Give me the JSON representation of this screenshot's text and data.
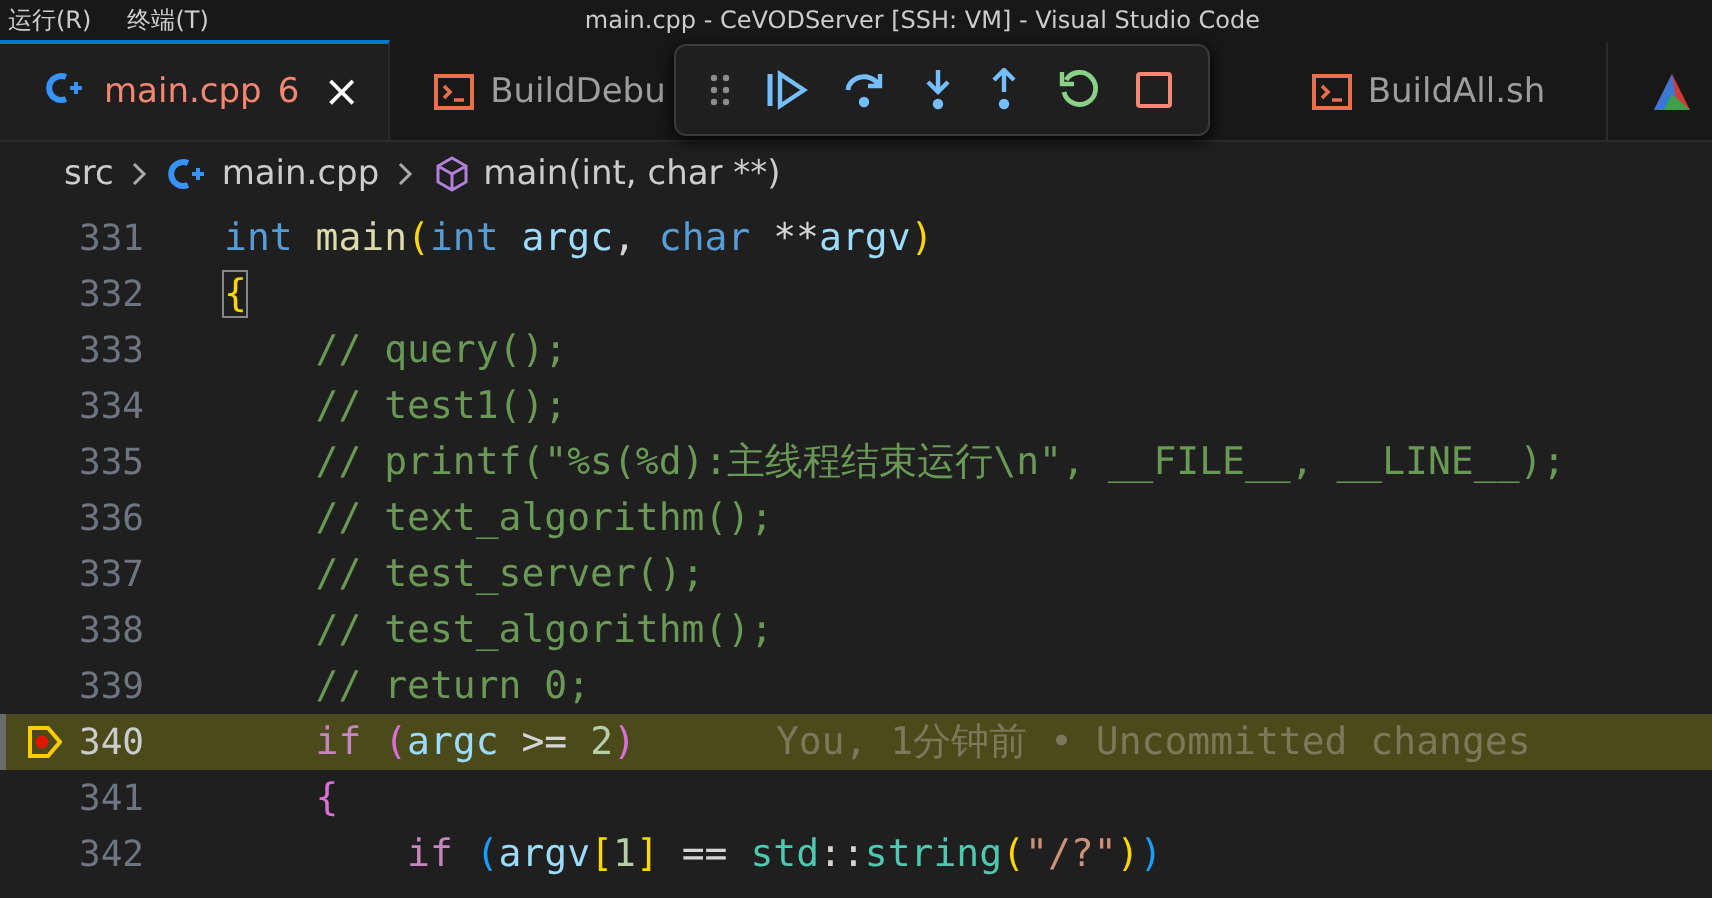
{
  "title_bar": {
    "menus": [
      "运行(R)",
      "终端(T)"
    ],
    "title": "main.cpp - CeVODServer [SSH: VM] - Visual Studio Code"
  },
  "tabs": [
    {
      "label": "main.cpp",
      "kind": "cpp",
      "problems": "6",
      "close": "×",
      "selected": true,
      "error": true
    },
    {
      "label": "BuildDebu",
      "kind": "shell",
      "selected": false,
      "error": false
    },
    {
      "label": "BuildAll.sh",
      "kind": "shell",
      "selected": false,
      "error": false
    },
    {
      "kind": "triangle",
      "selected": false
    }
  ],
  "debug_toolbar": [
    {
      "kind": "drag"
    },
    {
      "kind": "continue"
    },
    {
      "kind": "step-over"
    },
    {
      "kind": "step-into"
    },
    {
      "kind": "step-out"
    },
    {
      "kind": "restart"
    },
    {
      "kind": "stop"
    }
  ],
  "breadcrumb": [
    {
      "kind": "folder",
      "label": "src"
    },
    {
      "kind": "cpp",
      "label": "main.cpp"
    },
    {
      "kind": "symbol",
      "label": "main(int, char **)"
    }
  ],
  "lines": [
    {
      "number": "331",
      "current": false,
      "breakpoint": false,
      "tokens": [
        {
          "kind": "kw",
          "text": "int "
        },
        {
          "kind": "fn",
          "text": "main"
        },
        {
          "kind": "b1",
          "text": "("
        },
        {
          "kind": "kw",
          "text": "int "
        },
        {
          "kind": "var",
          "text": "argc"
        },
        {
          "kind": "plain",
          "text": ", "
        },
        {
          "kind": "kw",
          "text": "char"
        },
        {
          "kind": "plain",
          "text": " **"
        },
        {
          "kind": "var",
          "text": "argv"
        },
        {
          "kind": "b1",
          "text": ")"
        }
      ]
    },
    {
      "number": "332",
      "current": false,
      "breakpoint": false,
      "tokens": [
        {
          "kind": "b1match",
          "text": "{"
        }
      ]
    },
    {
      "number": "333",
      "current": false,
      "breakpoint": false,
      "tokens": [
        {
          "kind": "comment",
          "text": "    // query();"
        }
      ]
    },
    {
      "number": "334",
      "current": false,
      "breakpoint": false,
      "tokens": [
        {
          "kind": "comment",
          "text": "    // test1();"
        }
      ]
    },
    {
      "number": "335",
      "current": false,
      "breakpoint": false,
      "tokens": [
        {
          "kind": "comment",
          "text": "    // printf(\"%s(%d):主线程结束运行\\n\", __FILE__, __LINE__);"
        }
      ]
    },
    {
      "number": "336",
      "current": false,
      "breakpoint": false,
      "tokens": [
        {
          "kind": "comment",
          "text": "    // text_algorithm();"
        }
      ]
    },
    {
      "number": "337",
      "current": false,
      "breakpoint": false,
      "tokens": [
        {
          "kind": "comment",
          "text": "    // test_server();"
        }
      ]
    },
    {
      "number": "338",
      "current": false,
      "breakpoint": false,
      "tokens": [
        {
          "kind": "comment",
          "text": "    // test_algorithm();"
        }
      ]
    },
    {
      "number": "339",
      "current": false,
      "breakpoint": false,
      "tokens": [
        {
          "kind": "comment",
          "text": "    // return 0;"
        }
      ]
    },
    {
      "number": "340",
      "current": true,
      "breakpoint": true,
      "blame": "You, 1分钟前 • Uncommitted changes",
      "tokens": [
        {
          "kind": "ctrl",
          "text": "    if "
        },
        {
          "kind": "b2",
          "text": "("
        },
        {
          "kind": "var",
          "text": "argc"
        },
        {
          "kind": "plain",
          "text": " >= "
        },
        {
          "kind": "num",
          "text": "2"
        },
        {
          "kind": "b2",
          "text": ")"
        }
      ]
    },
    {
      "number": "341",
      "current": false,
      "breakpoint": false,
      "tokens": [
        {
          "kind": "b2",
          "text": "    {"
        }
      ]
    },
    {
      "number": "342",
      "current": false,
      "breakpoint": false,
      "tokens": [
        {
          "kind": "ctrl",
          "text": "        if "
        },
        {
          "kind": "b3",
          "text": "("
        },
        {
          "kind": "var",
          "text": "argv"
        },
        {
          "kind": "b1",
          "text": "["
        },
        {
          "kind": "num",
          "text": "1"
        },
        {
          "kind": "b1",
          "text": "]"
        },
        {
          "kind": "plain",
          "text": " == "
        },
        {
          "kind": "type",
          "text": "std"
        },
        {
          "kind": "plain",
          "text": "::"
        },
        {
          "kind": "type",
          "text": "string"
        },
        {
          "kind": "b1",
          "text": "("
        },
        {
          "kind": "str",
          "text": "\"/?\""
        },
        {
          "kind": "b1",
          "text": ")"
        },
        {
          "kind": "b3",
          "text": ")"
        }
      ]
    }
  ]
}
